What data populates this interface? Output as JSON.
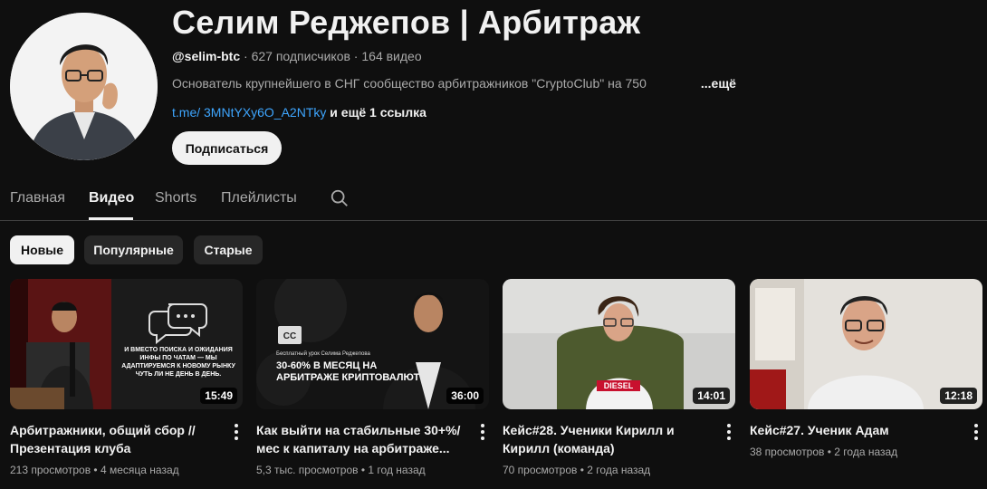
{
  "channel": {
    "title": "Селим Реджепов | Арбитраж",
    "handle": "@selim-btc",
    "subscribers": "627 подписчиков",
    "video_count": "164 видео",
    "separator": " · ",
    "description": "Основатель крупнейшего в СНГ сообщество арбитражников \"CryptoClub\" на 750",
    "more_label": "...ещё",
    "link_text": "t.me/ 3MNtYXy6O_A2NTky",
    "link_extra": "и ещё 1 ссылка",
    "subscribe_label": "Подписаться"
  },
  "tabs": [
    {
      "label": "Главная",
      "active": false
    },
    {
      "label": "Видео",
      "active": true
    },
    {
      "label": "Shorts",
      "active": false
    },
    {
      "label": "Плейлисты",
      "active": false
    }
  ],
  "chips": [
    {
      "label": "Новые",
      "selected": true
    },
    {
      "label": "Популярные",
      "selected": false
    },
    {
      "label": "Старые",
      "selected": false
    }
  ],
  "videos": [
    {
      "title": "Арбитражники, общий сбор // Презентация клуба CryptoClub.pro",
      "duration": "15:49",
      "views": "213 просмотров",
      "age": "4 месяца назад",
      "thumb_text": "И ВМЕСТО ПОИСКА И ОЖИДАНИЯ ИНФЫ ПО ЧАТАМ — МЫ АДАПТИРУЕМСЯ К НОВОМУ РЫНКУ ЧУТЬ ЛИ НЕ ДЕНЬ В ДЕНЬ."
    },
    {
      "title": "Как выйти на стабильные 30+%/мес к капиталу на арбитраже...",
      "duration": "36:00",
      "views": "5,3 тыс. просмотров",
      "age": "1 год назад",
      "thumb_small": "Бесплатный урок Селима Реджепова",
      "thumb_big": "30-60% В МЕСЯЦ НА АРБИТРАЖЕ КРИПТОВАЛЮТ"
    },
    {
      "title": "Кейс#28. Ученики Кирилл и Кирилл (команда)",
      "duration": "14:01",
      "views": "70 просмотров",
      "age": "2 года назад",
      "thumb_text": "DIESEL"
    },
    {
      "title": "Кейс#27. Ученик Адам",
      "duration": "12:18",
      "views": "38 просмотров",
      "age": "2 года назад"
    }
  ],
  "icons": {
    "search": "search-icon",
    "more": "more-vert-icon"
  },
  "colors": {
    "background": "#0f0f0f",
    "link": "#3ea6ff",
    "text_secondary": "#aaaaaa",
    "chip_bg": "#272727"
  }
}
